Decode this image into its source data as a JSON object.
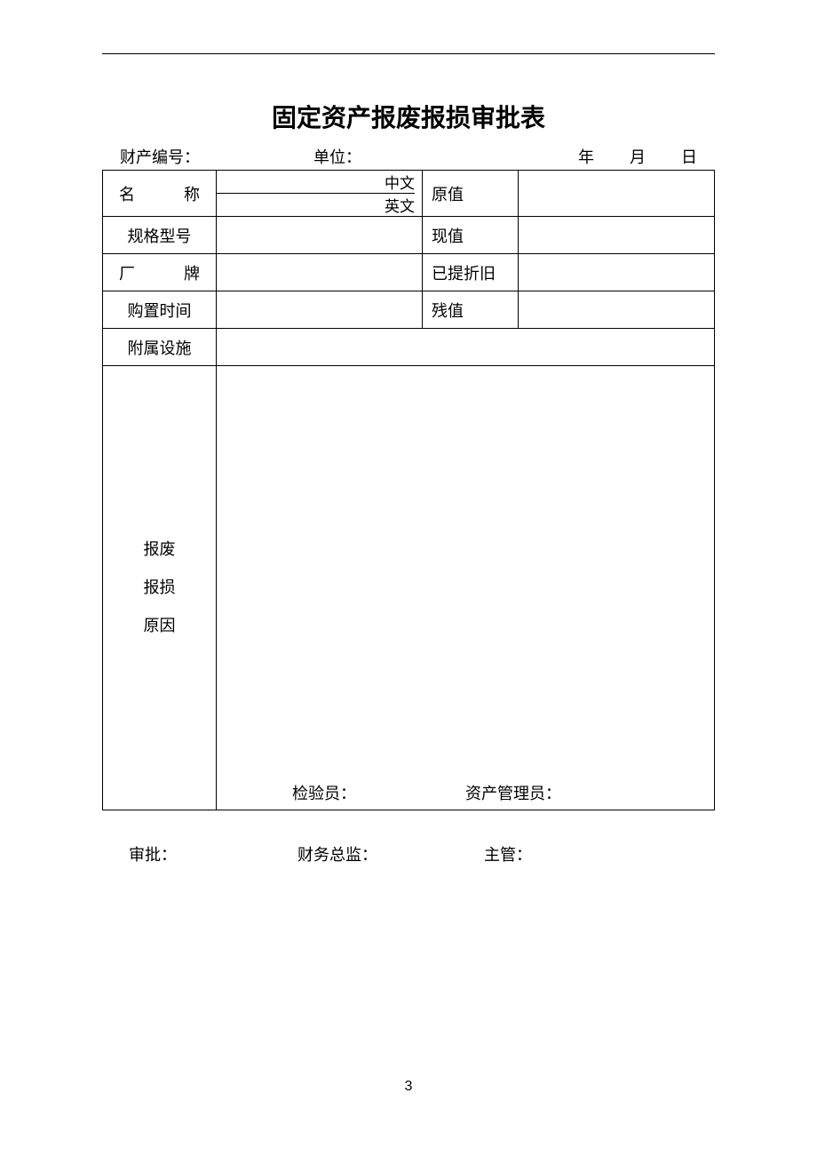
{
  "title": "固定资产报废报损审批表",
  "header": {
    "asset_no_label": "财产编号：",
    "unit_label": "单位：",
    "year_label": "年",
    "month_label": "月",
    "day_label": "日"
  },
  "rows": {
    "name_label": "名　　称",
    "name_zh_label": "中文",
    "name_en_label": "英文",
    "original_value_label": "原值",
    "spec_label": "规格型号",
    "current_value_label": "现值",
    "brand_label": "厂　　牌",
    "depreciation_label": "已提折旧",
    "purchase_time_label": "购置时间",
    "salvage_label": "残值",
    "accessory_label": "附属设施",
    "reason_line1": "报废",
    "reason_line2": "报损",
    "reason_line3": "原因",
    "inspector_label": "检验员：",
    "asset_manager_label": "资产管理员："
  },
  "approve": {
    "approve_label": "审批：",
    "finance_director_label": "财务总监：",
    "supervisor_label": "主管："
  },
  "page_number": "3"
}
